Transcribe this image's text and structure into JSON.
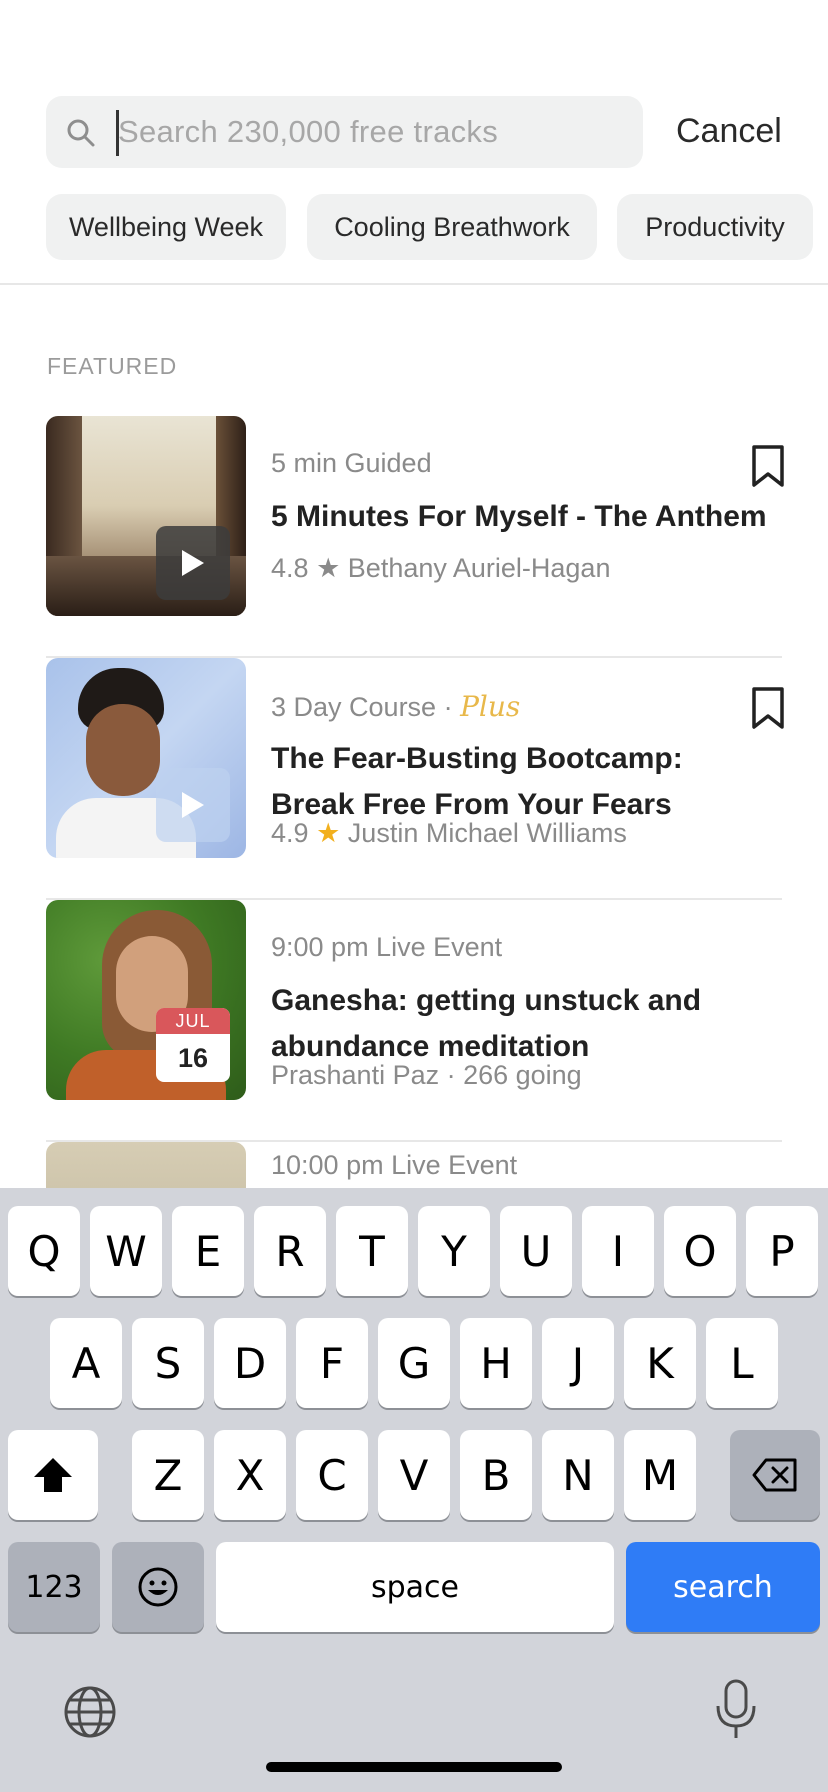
{
  "search": {
    "placeholder": "Search 230,000 free tracks",
    "cancel_label": "Cancel"
  },
  "chips": [
    "Wellbeing Week",
    "Cooling Breathwork",
    "Productivity"
  ],
  "section_label": "FEATURED",
  "items": [
    {
      "meta": "5 min Guided",
      "title": "5 Minutes For Myself - The Anthem",
      "rating": "4.8",
      "author": "Bethany Auriel-Hagan",
      "star_color": "#8a8a8a"
    },
    {
      "meta": "3 Day Course ·",
      "plus": "Plus",
      "title": "The Fear-Busting Bootcamp: Break Free From Your Fears",
      "rating": "4.9",
      "author": "Justin Michael Williams",
      "star_color": "#f2b01e"
    },
    {
      "meta": "9:00 pm Live Event",
      "title": "Ganesha: getting unstuck and abundance meditation",
      "sub": "Prashanti Paz · 266 going",
      "cal_month": "JUL",
      "cal_day": "16"
    },
    {
      "meta": "10:00 pm Live Event"
    }
  ],
  "keyboard": {
    "row1": [
      "Q",
      "W",
      "E",
      "R",
      "T",
      "Y",
      "U",
      "I",
      "O",
      "P"
    ],
    "row2": [
      "A",
      "S",
      "D",
      "F",
      "G",
      "H",
      "J",
      "K",
      "L"
    ],
    "row3": [
      "Z",
      "X",
      "C",
      "V",
      "B",
      "N",
      "M"
    ],
    "numbers_label": "123",
    "space_label": "space",
    "search_label": "search"
  },
  "icons": {
    "search": "search-icon",
    "bookmark": "bookmark-icon",
    "play": "play-icon",
    "shift": "shift-icon",
    "backspace": "backspace-icon",
    "emoji": "emoji-icon",
    "globe": "globe-icon",
    "mic": "microphone-icon"
  },
  "colors": {
    "accent_blue": "#2f7cf6",
    "plus_gold": "#e8b84a",
    "calendar_red": "#d9575b"
  }
}
